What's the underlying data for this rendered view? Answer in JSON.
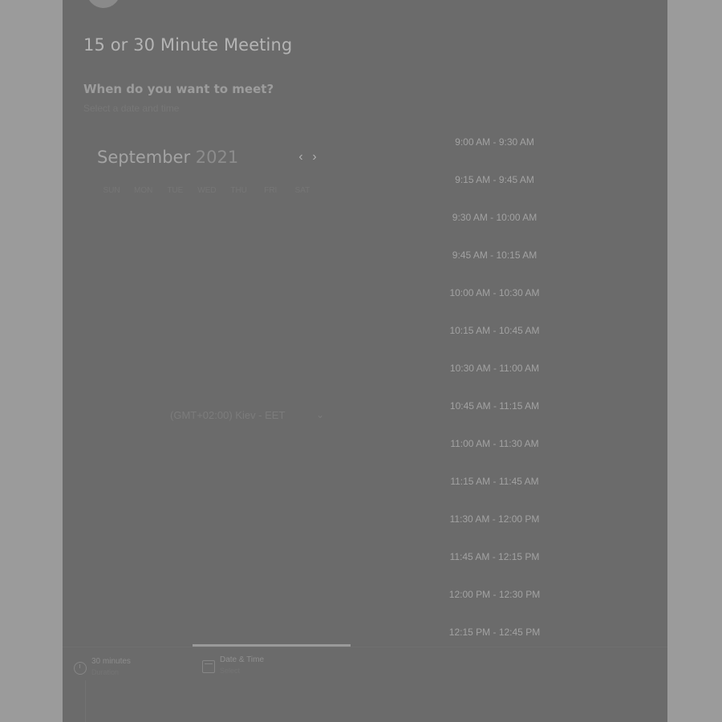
{
  "meeting": {
    "title": "15 or 30 Minute Meeting",
    "question": "When do you want to meet?",
    "subtitle": "Select a date and time"
  },
  "calendar": {
    "month": "September",
    "year": "2021",
    "weekdays": [
      "SUN",
      "MON",
      "TUE",
      "WED",
      "THU",
      "FRI",
      "SAT"
    ]
  },
  "timezone": {
    "value": "(GMT+02:00) Kiev - EET"
  },
  "time_slots": [
    "9:00 AM - 9:30 AM",
    "9:15 AM - 9:45 AM",
    "9:30 AM - 10:00 AM",
    "9:45 AM - 10:15 AM",
    "10:00 AM - 10:30 AM",
    "10:15 AM - 10:45 AM",
    "10:30 AM - 11:00 AM",
    "10:45 AM - 11:15 AM",
    "11:00 AM - 11:30 AM",
    "11:15 AM - 11:45 AM",
    "11:30 AM - 12:00 PM",
    "11:45 AM - 12:15 PM",
    "12:00 PM - 12:30 PM",
    "12:15 PM - 12:45 PM"
  ],
  "footer": {
    "duration_title": "30 minutes",
    "duration_sub": "Duration",
    "datetime_title": "Date & Time",
    "datetime_sub": "Select"
  },
  "icons": {
    "prev": "chevron-left-icon",
    "next": "chevron-right-icon",
    "timezone": "chevron-down-icon",
    "duration": "clock-icon",
    "datetime": "calendar-icon"
  }
}
